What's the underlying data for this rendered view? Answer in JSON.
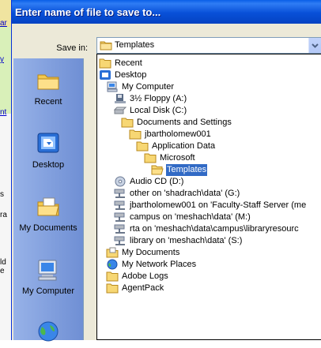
{
  "dialog": {
    "title": "Enter name of file to save to...",
    "save_in_label": "Save in:",
    "save_in_value": "Templates"
  },
  "places": [
    {
      "label": "Recent",
      "icon": "recent-folder-icon"
    },
    {
      "label": "Desktop",
      "icon": "desktop-icon"
    },
    {
      "label": "My Documents",
      "icon": "my-documents-icon"
    },
    {
      "label": "My Computer",
      "icon": "my-computer-icon"
    },
    {
      "label": "",
      "icon": "network-globe-icon"
    }
  ],
  "list_items": [
    {
      "label": "Recent",
      "icon": "folder-icon"
    },
    {
      "label": "Desktop",
      "icon": "desktop-icon"
    },
    {
      "label": "My Computer",
      "icon": "my-computer-icon"
    },
    {
      "label": "3½ Floppy (A:)",
      "icon": "floppy-icon"
    },
    {
      "label": "Local Disk (C:)",
      "icon": "hard-disk-icon"
    },
    {
      "label": "Documents and Settings",
      "icon": "folder-icon"
    },
    {
      "label": "jbartholomew001",
      "icon": "folder-icon"
    },
    {
      "label": "Application Data",
      "icon": "folder-icon"
    },
    {
      "label": "Microsoft",
      "icon": "folder-icon"
    },
    {
      "label": "Templates",
      "icon": "open-folder-icon",
      "selected": true
    },
    {
      "label": "Audio CD (D:)",
      "icon": "cd-icon"
    },
    {
      "label": "other on 'shadrach\\data' (G:)",
      "icon": "network-drive-icon"
    },
    {
      "label": "jbartholomew001 on 'Faculty-Staff Server (me",
      "icon": "network-drive-icon"
    },
    {
      "label": "campus on 'meshach\\data' (M:)",
      "icon": "network-drive-icon"
    },
    {
      "label": "rta on 'meshach\\data\\campus\\libraryresourc",
      "icon": "network-drive-icon"
    },
    {
      "label": "library on 'meshach\\data' (S:)",
      "icon": "network-drive-icon"
    },
    {
      "label": "My Documents",
      "icon": "my-documents-icon"
    },
    {
      "label": "My Network Places",
      "icon": "network-places-icon"
    },
    {
      "label": "Adobe Logs",
      "icon": "folder-icon"
    },
    {
      "label": "AgentPack",
      "icon": "folder-icon"
    }
  ],
  "background": {
    "fragments": [
      "ar",
      "y",
      "nt",
      "s",
      "ra",
      "ld",
      "e"
    ]
  },
  "colors": {
    "titlebar": "#0a5fe8",
    "dialog_face": "#ece9d8",
    "selection": "#316ac5",
    "places_bar": "#7f9fdf"
  }
}
